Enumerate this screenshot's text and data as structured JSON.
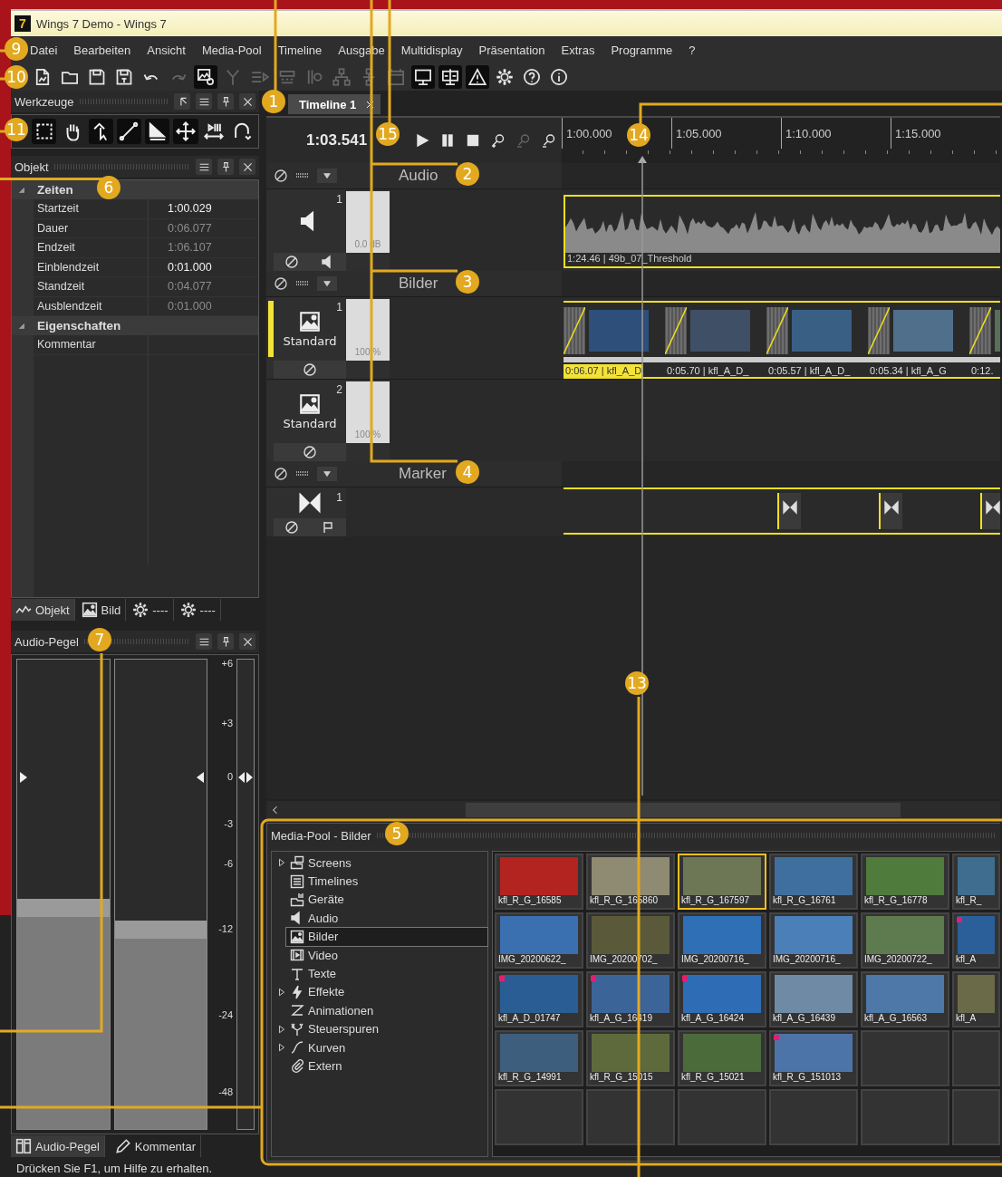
{
  "window": {
    "app_icon": "7",
    "title": "Wings 7 Demo - Wings 7"
  },
  "menu": [
    "Datei",
    "Bearbeiten",
    "Ansicht",
    "Media-Pool",
    "Timeline",
    "Ausgabe",
    "Multidisplay",
    "Präsentation",
    "Extras",
    "Programme",
    "?"
  ],
  "toolbar": [
    {
      "kind": "new",
      "disabled": false,
      "active": false
    },
    {
      "kind": "open",
      "disabled": false,
      "active": false
    },
    {
      "kind": "save",
      "disabled": false,
      "active": false
    },
    {
      "kind": "saveas",
      "disabled": false,
      "active": false
    },
    {
      "kind": "undo",
      "disabled": false,
      "active": false
    },
    {
      "kind": "redo",
      "disabled": true,
      "active": false
    },
    {
      "kind": "media",
      "disabled": false,
      "active": true
    },
    {
      "kind": "branch",
      "disabled": true,
      "active": false
    },
    {
      "kind": "lines",
      "disabled": true,
      "active": false
    },
    {
      "kind": "rec",
      "disabled": true,
      "active": false
    },
    {
      "kind": "split",
      "disabled": true,
      "active": false
    },
    {
      "kind": "tree",
      "disabled": true,
      "active": false
    },
    {
      "kind": "tree2",
      "disabled": true,
      "active": false
    },
    {
      "kind": "calendar",
      "disabled": true,
      "active": false
    },
    {
      "kind": "monitor",
      "disabled": false,
      "active": true
    },
    {
      "kind": "splitmon",
      "disabled": false,
      "active": true
    },
    {
      "kind": "warning",
      "disabled": false,
      "active": true
    },
    {
      "kind": "gear",
      "disabled": false,
      "active": false
    },
    {
      "kind": "help",
      "disabled": false,
      "active": false
    },
    {
      "kind": "info",
      "disabled": false,
      "active": false
    }
  ],
  "tools_panel": {
    "title": "Werkzeuge",
    "tools": [
      {
        "kind": "rect",
        "active": true
      },
      {
        "kind": "hand",
        "active": false
      },
      {
        "kind": "pointer",
        "active": true
      },
      {
        "kind": "line",
        "active": true
      },
      {
        "kind": "shape",
        "active": true
      },
      {
        "kind": "move",
        "active": true
      },
      {
        "kind": "fit",
        "active": false
      },
      {
        "kind": "magnet",
        "active": false
      }
    ]
  },
  "object_panel": {
    "title": "Objekt",
    "groups": [
      {
        "label": "Zeiten",
        "expanded": true,
        "rows": [
          {
            "name": "Startzeit",
            "value": "1:00.029",
            "readonly": false
          },
          {
            "name": "Dauer",
            "value": "0:06.077",
            "readonly": true
          },
          {
            "name": "Endzeit",
            "value": "1:06.107",
            "readonly": true
          },
          {
            "name": "Einblendzeit",
            "value": "0:01.000",
            "readonly": false
          },
          {
            "name": "Standzeit",
            "value": "0:04.077",
            "readonly": true
          },
          {
            "name": "Ausblendzeit",
            "value": "0:01.000",
            "readonly": true
          }
        ]
      },
      {
        "label": "Eigenschaften",
        "expanded": true,
        "rows": [
          {
            "name": "Kommentar"
          }
        ]
      }
    ],
    "tabs": [
      {
        "kind": "wave",
        "label": "Objekt",
        "selected": true
      },
      {
        "kind": "picture",
        "label": "Bild",
        "selected": false
      },
      {
        "kind": "gear",
        "label": "----",
        "selected": false
      },
      {
        "kind": "gear",
        "label": "----",
        "selected": false
      }
    ]
  },
  "audio_panel": {
    "title": "Audio-Pegel",
    "meters": [
      {
        "level": 0.49
      },
      {
        "level": 0.445
      }
    ],
    "scale": [
      "+6",
      "+3",
      "0",
      "-3",
      "-6",
      "-12",
      "-24",
      "-48"
    ],
    "tabs": [
      {
        "kind": "lr",
        "label": "Audio-Pegel",
        "selected": true
      },
      {
        "kind": "pencil",
        "label": "Kommentar",
        "selected": false
      }
    ]
  },
  "timeline": {
    "tab": {
      "label": "Timeline 1",
      "selected": true
    },
    "time": "1:03.541",
    "transport": [
      {
        "kind": "play",
        "disabled": false
      },
      {
        "kind": "pause",
        "disabled": false
      },
      {
        "kind": "stop",
        "disabled": false
      },
      {
        "kind": "zoomin",
        "disabled": false
      },
      {
        "kind": "zoomout",
        "disabled": true
      },
      {
        "kind": "zoomfit",
        "disabled": false
      }
    ],
    "ruler": [
      "1:00.000",
      "1:05.000",
      "1:10.000",
      "1:15.000"
    ],
    "groups": [
      {
        "label": "Audio",
        "tracks": [
          {
            "kind": "audio",
            "number": "1",
            "level_text": "0.0 dB",
            "selected": false,
            "clips": [
              {
                "label": "1:24.46 | 49b_07_Threshold"
              }
            ]
          }
        ]
      },
      {
        "label": "Bilder",
        "tracks": [
          {
            "kind": "images",
            "number": "1",
            "label": "Standard",
            "level_text": "100 %",
            "selected": true,
            "clips": [
              {
                "label": "0:06.07 | kfl_A_D",
                "selected": true
              },
              {
                "label": "0:05.70 | kfl_A_D_",
                "selected": false
              },
              {
                "label": "0:05.57 | kfl_A_D_",
                "selected": false
              },
              {
                "label": "0:05.34 | kfl_A_G",
                "selected": false
              },
              {
                "label": "0:12.",
                "selected": false
              }
            ]
          },
          {
            "kind": "images",
            "number": "2",
            "label": "Standard",
            "level_text": "100 %",
            "selected": false
          }
        ]
      },
      {
        "label": "Marker",
        "tracks": [
          {
            "kind": "marker",
            "number": "1",
            "selected": false
          }
        ]
      }
    ]
  },
  "media_pool": {
    "title": "Media-Pool - Bilder",
    "tree": [
      {
        "kind": "screens",
        "label": "Screens",
        "expandable": true,
        "selected": false
      },
      {
        "kind": "timelines",
        "label": "Timelines",
        "expandable": false,
        "selected": false
      },
      {
        "kind": "devices",
        "label": "Geräte",
        "expandable": false,
        "selected": false
      },
      {
        "kind": "audio",
        "label": "Audio",
        "expandable": false,
        "selected": false
      },
      {
        "kind": "bilder",
        "label": "Bilder",
        "expandable": false,
        "selected": true
      },
      {
        "kind": "video",
        "label": "Video",
        "expandable": false,
        "selected": false
      },
      {
        "kind": "text",
        "label": "Texte",
        "expandable": false,
        "selected": false
      },
      {
        "kind": "effects",
        "label": "Effekte",
        "expandable": true,
        "selected": false
      },
      {
        "kind": "anim",
        "label": "Animationen",
        "expandable": false,
        "selected": false
      },
      {
        "kind": "control",
        "label": "Steuerspuren",
        "expandable": true,
        "selected": false
      },
      {
        "kind": "curves",
        "label": "Kurven",
        "expandable": true,
        "selected": false
      },
      {
        "kind": "extern",
        "label": "Extern",
        "expandable": false,
        "selected": false
      }
    ],
    "items": [
      {
        "label": "kfl_R_G_16585",
        "selected": false,
        "marked": false
      },
      {
        "label": "kfl_R_G_165860",
        "selected": false,
        "marked": false
      },
      {
        "label": "kfl_R_G_167597",
        "selected": true,
        "marked": false
      },
      {
        "label": "kfl_R_G_16761",
        "selected": false,
        "marked": false
      },
      {
        "label": "kfl_R_G_16778",
        "selected": false,
        "marked": false
      },
      {
        "label": "kfl_R_",
        "selected": false,
        "marked": false
      },
      {
        "label": "IMG_20200622_",
        "selected": false,
        "marked": false
      },
      {
        "label": "IMG_20200702_",
        "selected": false,
        "marked": false
      },
      {
        "label": "IMG_20200716_",
        "selected": false,
        "marked": false
      },
      {
        "label": "IMG_20200716_",
        "selected": false,
        "marked": false
      },
      {
        "label": "IMG_20200722_",
        "selected": false,
        "marked": false
      },
      {
        "label": "kfl_A",
        "selected": false,
        "marked": true
      },
      {
        "label": "kfl_A_D_01747",
        "selected": false,
        "marked": true
      },
      {
        "label": "kfl_A_G_16419",
        "selected": false,
        "marked": true
      },
      {
        "label": "kfl_A_G_16424",
        "selected": false,
        "marked": true
      },
      {
        "label": "kfl_A_G_16439",
        "selected": false,
        "marked": false
      },
      {
        "label": "kfl_A_G_16563",
        "selected": false,
        "marked": false
      },
      {
        "label": "kfl_A",
        "selected": false,
        "marked": false
      },
      {
        "label": "kfl_R_G_14991",
        "selected": false,
        "marked": false
      },
      {
        "label": "kfl_R_G_15015",
        "selected": false,
        "marked": false
      },
      {
        "label": "kfl_R_G_15021",
        "selected": false,
        "marked": false
      },
      {
        "label": "kfl_R_G_151013",
        "selected": false,
        "marked": true
      }
    ]
  },
  "status_bar": "Drücken Sie F1, um Hilfe zu erhalten.",
  "callouts": [
    {
      "label": "9"
    },
    {
      "label": "10"
    },
    {
      "label": "1"
    },
    {
      "label": "15"
    },
    {
      "label": "14"
    },
    {
      "label": "11"
    },
    {
      "label": "2"
    },
    {
      "label": "6"
    },
    {
      "label": "3"
    },
    {
      "label": "4"
    },
    {
      "label": "7"
    },
    {
      "label": "13"
    },
    {
      "label": "5"
    }
  ]
}
